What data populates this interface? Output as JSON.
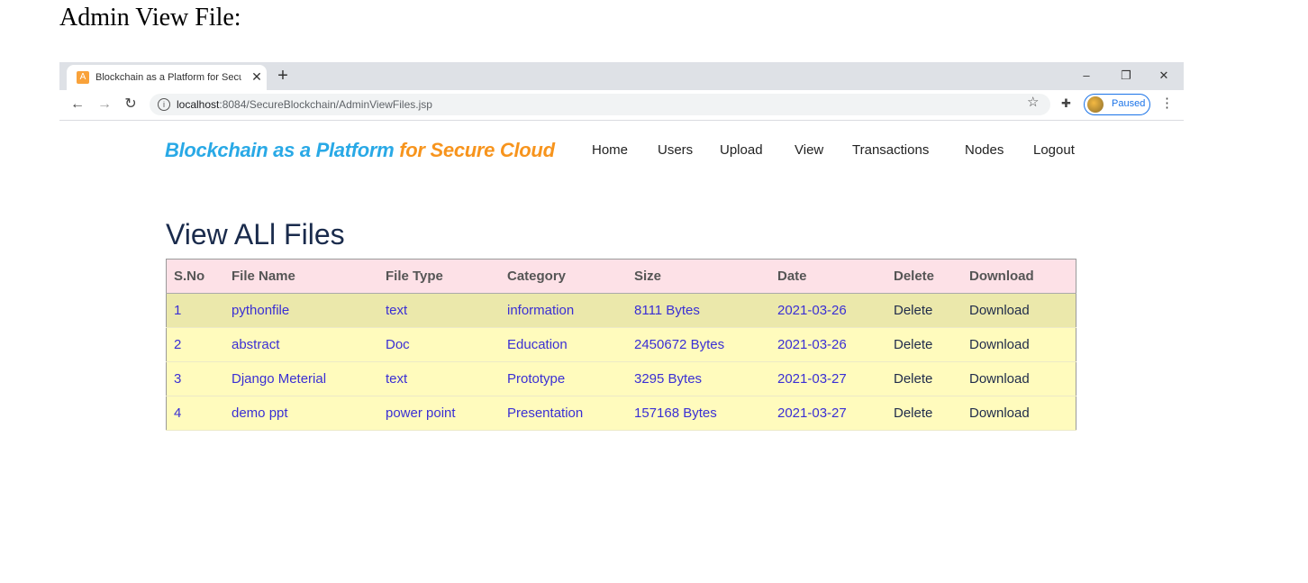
{
  "doc_heading": "Admin View File:",
  "browser": {
    "tab_title": "Blockchain as a Platform for Secu",
    "tab_favicon": "A",
    "url_host": "localhost",
    "url_path": ":8084/SecureBlockchain/AdminViewFiles.jsp",
    "profile_status": "Paused"
  },
  "site": {
    "brand_part1": "Blockchain as a Platform",
    "brand_part2": "for Secure Cloud",
    "nav": [
      "Home",
      "Users",
      "Upload",
      "View",
      "Transactions",
      "Nodes",
      "Logout"
    ]
  },
  "page_title": "View ALl Files",
  "table": {
    "headers": [
      "S.No",
      "File Name",
      "File Type",
      "Category",
      "Size",
      "Date",
      "Delete",
      "Download"
    ],
    "rows": [
      {
        "sno": "1",
        "name": "pythonfile",
        "type": "text",
        "category": "information",
        "size": "8111 Bytes",
        "date": "2021-03-26",
        "delete": "Delete",
        "download": "Download"
      },
      {
        "sno": "2",
        "name": "abstract",
        "type": "Doc",
        "category": "Education",
        "size": "2450672 Bytes",
        "date": "2021-03-26",
        "delete": "Delete",
        "download": "Download"
      },
      {
        "sno": "3",
        "name": "Django Meterial",
        "type": "text",
        "category": "Prototype",
        "size": "3295 Bytes",
        "date": "2021-03-27",
        "delete": "Delete",
        "download": "Download"
      },
      {
        "sno": "4",
        "name": "demo ppt",
        "type": "power point",
        "category": "Presentation",
        "size": "157168 Bytes",
        "date": "2021-03-27",
        "delete": "Delete",
        "download": "Download"
      }
    ]
  },
  "icons": {
    "favicon": "a-favicon-icon",
    "close": "close-icon",
    "new_tab": "plus-icon",
    "back": "back-arrow-icon",
    "forward": "forward-arrow-icon",
    "reload": "reload-icon",
    "info": "info-icon",
    "star": "star-icon",
    "extensions": "puzzle-icon",
    "menu": "kebab-menu-icon"
  },
  "colors": {
    "brand_blue": "#29a9e6",
    "brand_orange": "#f7941d",
    "header_bg": "#fde1e7",
    "row_bg": "#fffbbd",
    "row_highlight_bg": "#ebe8ab",
    "link_text": "#3a2fd4"
  }
}
